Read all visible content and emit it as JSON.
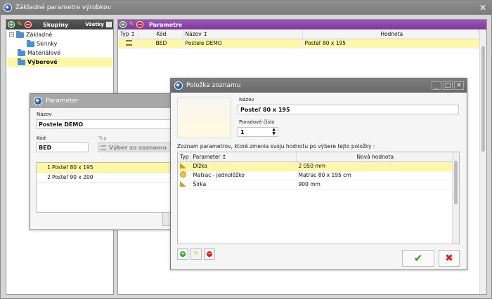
{
  "main": {
    "title": "Základné parametre výrobkov",
    "close_glyph": "✕"
  },
  "groups": {
    "header": "Skupiny",
    "all_label": "Všetky",
    "tree": [
      {
        "label": "Základné",
        "toggle": "−"
      },
      {
        "label": "Skrinky"
      },
      {
        "label": "Materiálové"
      },
      {
        "label": "Výberové"
      }
    ]
  },
  "params": {
    "header": "Parametre",
    "columns": {
      "typ": "Typ",
      "typ_sort": "↥",
      "kod": "Kód",
      "nazov": "Názov",
      "nazov_sort": "↥",
      "hodnota": "Hodnota"
    },
    "rows": [
      {
        "kod": "BED",
        "nazov": "Postele DEMO",
        "hodnota": "Posteľ 80 x 195",
        "icon": "list-icon"
      }
    ]
  },
  "param_dialog": {
    "title": "Parameter",
    "name_label": "Názov",
    "name_value": "Postele DEMO",
    "code_label": "Kód",
    "code_value": "BED",
    "type_label": "Typ",
    "type_value": "Výber zo zoznamu",
    "items": [
      {
        "num": "1",
        "label": "Posteľ 80 x 195"
      },
      {
        "num": "2",
        "label": "Posteľ 90 x 200"
      }
    ]
  },
  "item_dialog": {
    "title": "Položka zoznamu",
    "name_label": "Názov",
    "name_value": "Posteľ 80 x 195",
    "order_label": "Poradové číslo",
    "order_value": "1",
    "list_caption": "Zoznam parametrov, ktoré zmenia svoju hodnotu po výbere tejto položky :",
    "columns": {
      "typ": "Typ",
      "parameter": "Parameter",
      "parameter_sort": "↥",
      "nova": "Nová hodnota"
    },
    "rows": [
      {
        "parameter": "Dĺžka",
        "value": "2 050 mm",
        "icon": "ruler-icon"
      },
      {
        "parameter": "Matrac - jednolôžko",
        "value": "Matrac 80 x 195 cm",
        "icon": "circle-icon"
      },
      {
        "parameter": "Šírka",
        "value": "900 mm",
        "icon": "ruler-icon"
      }
    ],
    "ok_glyph": "✔",
    "cancel_glyph": "✖",
    "window_buttons": [
      "_",
      "□",
      "✕"
    ]
  },
  "colors": {
    "selected_row": "#fff7a8",
    "purple_header": "#8a47a8"
  }
}
